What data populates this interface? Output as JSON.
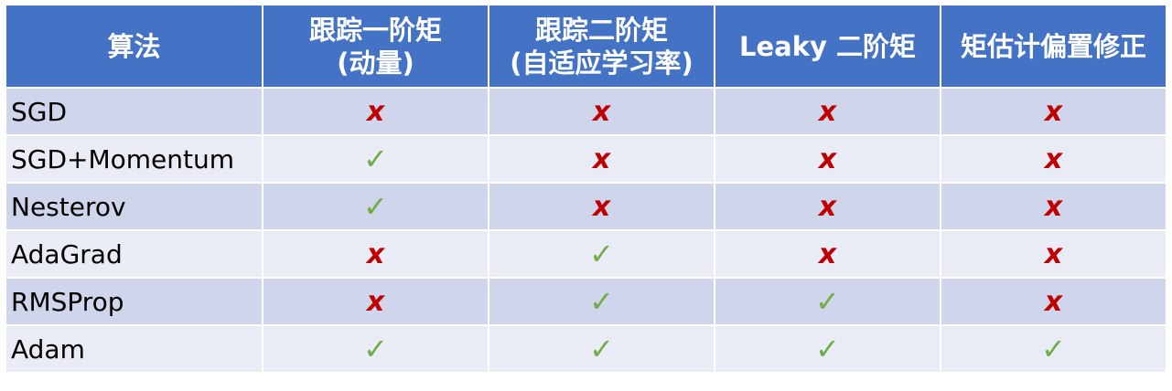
{
  "table": {
    "headers": [
      {
        "line1": "算法",
        "line2": ""
      },
      {
        "line1": "跟踪一阶矩",
        "line2": "(动量)"
      },
      {
        "line1": "跟踪二阶矩",
        "line2": "(自适应学习率)"
      },
      {
        "line1": "Leaky 二阶矩",
        "line2": ""
      },
      {
        "line1": "矩估计偏置修正",
        "line2": ""
      }
    ],
    "rows": [
      {
        "name": "SGD",
        "cells": [
          "x",
          "x",
          "x",
          "x"
        ]
      },
      {
        "name": "SGD+Momentum",
        "cells": [
          "✓",
          "x",
          "x",
          "x"
        ]
      },
      {
        "name": "Nesterov",
        "cells": [
          "✓",
          "x",
          "x",
          "x"
        ]
      },
      {
        "name": "AdaGrad",
        "cells": [
          "x",
          "✓",
          "x",
          "x"
        ]
      },
      {
        "name": "RMSProp",
        "cells": [
          "x",
          "✓",
          "✓",
          "x"
        ]
      },
      {
        "name": "Adam",
        "cells": [
          "✓",
          "✓",
          "✓",
          "✓"
        ]
      }
    ]
  },
  "colors": {
    "header_bg": "#4472c4",
    "row_odd_bg": "#cfd5ea",
    "row_even_bg": "#e9ebf5",
    "x_mark": "#c00000",
    "check_mark": "#70ad47"
  },
  "icons": {
    "x": "cross-icon",
    "check": "check-icon"
  }
}
